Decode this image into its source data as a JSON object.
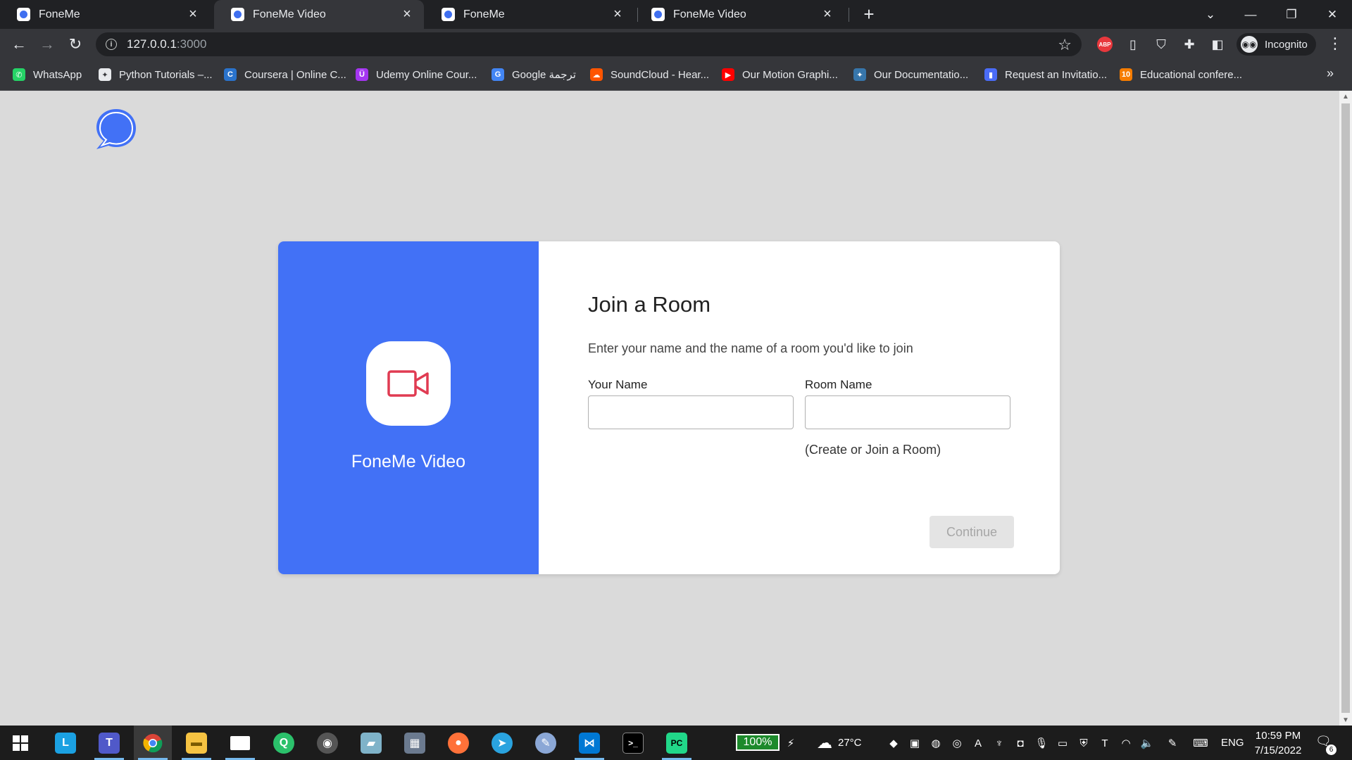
{
  "browser": {
    "tabs": [
      {
        "title": "FoneMe",
        "active": false
      },
      {
        "title": "FoneMe Video",
        "active": true
      },
      {
        "title": "FoneMe",
        "active": false
      },
      {
        "title": "FoneMe Video",
        "active": false
      }
    ],
    "url_host": "127.0.0.1",
    "url_port": ":3000",
    "profile_label": "Incognito",
    "bookmarks": [
      {
        "label": "WhatsApp",
        "icon": "whatsapp-icon",
        "color": "#25d366"
      },
      {
        "label": "Python Tutorials –...",
        "icon": "python-icon",
        "color": "#e8eaed"
      },
      {
        "label": "Coursera | Online C...",
        "icon": "coursera-icon",
        "color": "#2a73cc"
      },
      {
        "label": "Udemy Online Cour...",
        "icon": "udemy-icon",
        "color": "#a435f0"
      },
      {
        "label": "Google ترجمة",
        "icon": "google-translate-icon",
        "color": "#4285f4"
      },
      {
        "label": "SoundCloud - Hear...",
        "icon": "soundcloud-icon",
        "color": "#ff5500"
      },
      {
        "label": "Our Motion Graphi...",
        "icon": "youtube-icon",
        "color": "#ff0000"
      },
      {
        "label": "Our Documentatio...",
        "icon": "python-docs-icon",
        "color": "#3776ab"
      },
      {
        "label": "Request an Invitatio...",
        "icon": "bar-chart-icon",
        "color": "#4a6cf7"
      },
      {
        "label": "Educational confere...",
        "icon": "number-ten-icon",
        "color": "#f57c00"
      }
    ]
  },
  "page": {
    "brand_color": "#4271f6",
    "app_name": "FoneMe Video",
    "heading": "Join a Room",
    "subtitle": "Enter your name and the name of a room you'd like to join",
    "name_label": "Your Name",
    "name_value": "",
    "room_label": "Room Name",
    "room_value": "",
    "room_hint": "(Create or Join a Room)",
    "continue_label": "Continue"
  },
  "taskbar": {
    "battery": "100%",
    "weather": "27°C",
    "language": "ENG",
    "time": "10:59 PM",
    "date": "7/15/2022",
    "notifications": "6"
  }
}
